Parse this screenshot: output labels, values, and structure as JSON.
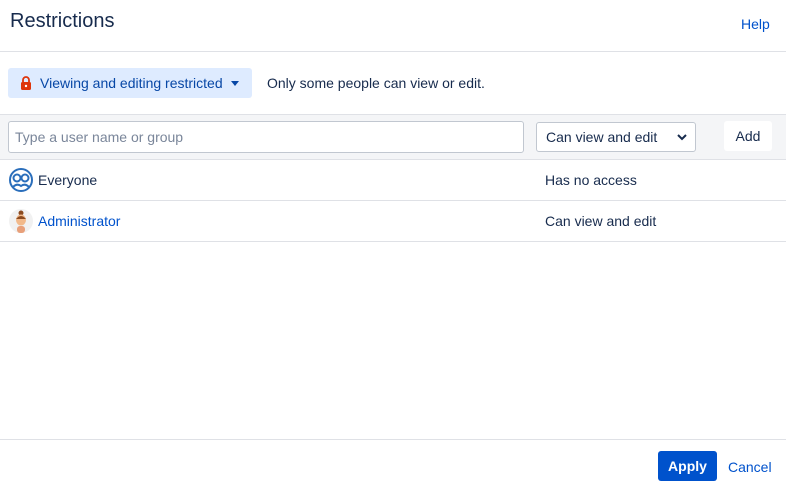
{
  "dialog": {
    "title": "Restrictions",
    "help_link": "Help"
  },
  "restriction": {
    "mode_label": "Viewing and editing restricted",
    "description": "Only some people can view or edit."
  },
  "add_bar": {
    "search_placeholder": "Type a user name or group",
    "search_value": "",
    "permission_selected": "Can view and edit",
    "add_label": "Add"
  },
  "entries": [
    {
      "name": "Everyone",
      "access": "Has no access",
      "icon": "group-icon"
    },
    {
      "name": "Administrator",
      "access": "Can view and edit",
      "icon": "user-avatar"
    }
  ],
  "footer": {
    "apply_label": "Apply",
    "cancel_label": "Cancel"
  },
  "colors": {
    "accent": "#0052cc",
    "lock": "#de350b",
    "restrict_bg": "#deebff"
  }
}
